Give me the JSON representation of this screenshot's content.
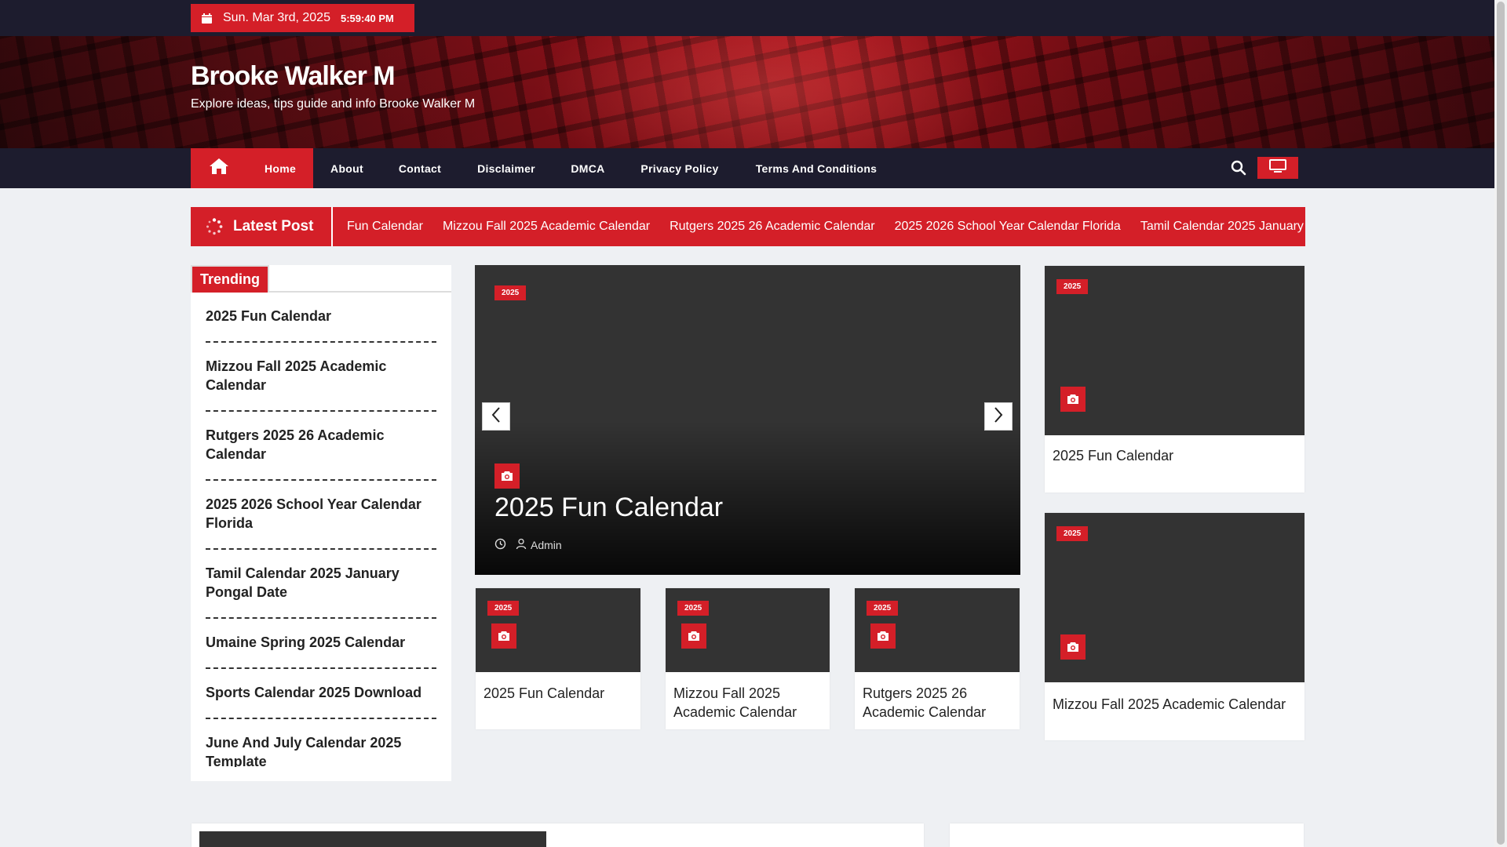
{
  "topbar": {
    "date": "Sun. Mar 3rd, 2025",
    "time": "5:59:40 PM"
  },
  "header": {
    "site_title": "Brooke Walker M",
    "site_description": "Explore ideas, tips guide and info Brooke Walker M"
  },
  "nav": {
    "items": [
      {
        "label": "Home"
      },
      {
        "label": "About"
      },
      {
        "label": "Contact"
      },
      {
        "label": "Disclaimer"
      },
      {
        "label": "DMCA"
      },
      {
        "label": "Privacy Policy"
      },
      {
        "label": "Terms And Conditions"
      }
    ],
    "icons": [
      "home-icon",
      "search-icon",
      "monitor-icon"
    ]
  },
  "ticker": {
    "label": "Latest Post",
    "items": [
      "Fun Calendar",
      "Mizzou Fall 2025 Academic Calendar",
      "Rutgers 2025 26 Academic Calendar",
      "2025 2026 School Year Calendar Florida",
      "Tamil Calendar 2025 January"
    ]
  },
  "trending": {
    "label": "Trending",
    "items": [
      "2025 Fun Calendar",
      "Mizzou Fall 2025 Academic Calendar",
      "Rutgers 2025 26 Academic Calendar",
      "2025 2026 School Year Calendar Florida",
      "Tamil Calendar 2025 January Pongal Date",
      "Umaine Spring 2025 Calendar",
      "Sports Calendar 2025 Download",
      "June And July Calendar 2025 Template"
    ]
  },
  "slider": {
    "category": "2025",
    "title": "2025 Fun Calendar",
    "author": "Admin"
  },
  "small_cards": [
    {
      "category": "2025",
      "title": "2025 Fun Calendar"
    },
    {
      "category": "2025",
      "title": "Mizzou Fall 2025 Academic Calendar"
    },
    {
      "category": "2025",
      "title": "Rutgers 2025 26 Academic Calendar"
    }
  ],
  "side_cards": [
    {
      "category": "2025",
      "title": "2025 Fun Calendar"
    },
    {
      "category": "2025",
      "title": "Mizzou Fall 2025 Academic Calendar"
    }
  ],
  "colors": {
    "accent": "#d41f28",
    "dark": "#1d1c2e",
    "image_placeholder": "#333333"
  }
}
